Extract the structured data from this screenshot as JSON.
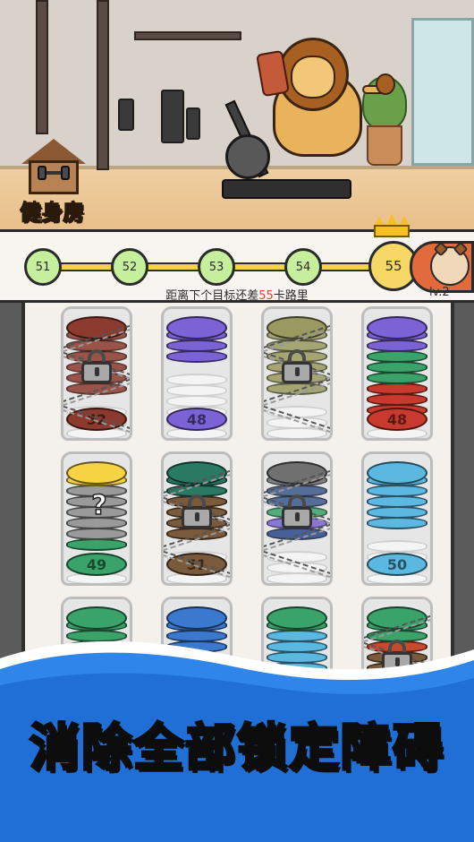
{
  "location": {
    "name": "健身房"
  },
  "progress": {
    "nodes": [
      "51",
      "52",
      "53",
      "54",
      "55"
    ],
    "current_node": "55",
    "target_prefix": "距离下个目标还差",
    "target_value": "55",
    "target_suffix": "卡路里",
    "level": "lv.2"
  },
  "tubes": [
    {
      "id": "t1",
      "locked": true,
      "colors": [
        "#8c3a2e",
        "#8c3a2e",
        "#8c3a2e",
        "#8c3a2e",
        "#8c3a2e",
        "#8c3a2e",
        "#8c3a2e"
      ],
      "label": "52",
      "faded": true
    },
    {
      "id": "t2",
      "locked": false,
      "colors": [
        "#7b63d6",
        "#7b63d6",
        "#7b63d6",
        "#7b63d6"
      ],
      "label": "48"
    },
    {
      "id": "t3",
      "locked": true,
      "colors": [
        "#9a9a60",
        "#9a9a60",
        "#9a9a60",
        "#9a9a60",
        "#9a9a60",
        "#9a9a60",
        "#9a9a60"
      ],
      "label": "",
      "faded": true
    },
    {
      "id": "t4",
      "locked": false,
      "colors": [
        "#7b63d6",
        "#7b63d6",
        "#7b63d6",
        "#3aa36a",
        "#3aa36a",
        "#3aa36a",
        "#c83a2e",
        "#c83a2e",
        "#c83a2e"
      ],
      "label": "48"
    },
    {
      "id": "t5",
      "locked": false,
      "mystery": true,
      "colors": [
        "#f5d342",
        "#f5d342",
        "#9a9a9a",
        "#9a9a9a",
        "#9a9a9a",
        "#9a9a9a",
        "#9a9a9a",
        "#3aa36a"
      ],
      "label": "49"
    },
    {
      "id": "t6",
      "locked": true,
      "colors": [
        "#2a7a63",
        "#2a7a63",
        "#2a7a63",
        "#7a5a3a",
        "#7a5a3a",
        "#7a5a3a",
        "#7a5a3a"
      ],
      "label": "51"
    },
    {
      "id": "t7",
      "locked": true,
      "colors": [
        "#707070",
        "#707070",
        "#3b5a8a",
        "#3b5a8a",
        "#3aa36a",
        "#7b63d6",
        "#2a4a8a"
      ],
      "label": "",
      "faded": true
    },
    {
      "id": "t8",
      "locked": false,
      "colors": [
        "#5bb8e0",
        "#5bb8e0",
        "#5bb8e0",
        "#5bb8e0",
        "#5bb8e0",
        "#5bb8e0"
      ],
      "label": "50"
    },
    {
      "id": "t9",
      "locked": false,
      "colors": [
        "#3aa36a",
        "#3aa36a",
        "#3aa36a",
        "#3aa36a",
        "#3aa36a"
      ],
      "label": ""
    },
    {
      "id": "t10",
      "locked": false,
      "colors": [
        "#3b79cf",
        "#3b79cf",
        "#3b79cf",
        "#3b79cf",
        "#3b79cf"
      ],
      "label": ""
    },
    {
      "id": "t11",
      "locked": false,
      "colors": [
        "#3aa36a",
        "#3aa36a",
        "#5bb8e0",
        "#5bb8e0",
        "#5bb8e0",
        "#5bb8e0"
      ],
      "label": ""
    },
    {
      "id": "t12",
      "locked": true,
      "colors": [
        "#3aa36a",
        "#3aa36a",
        "#3aa36a",
        "#c84a2e",
        "#7a5a3a",
        "#7a5a3a"
      ],
      "label": ""
    }
  ],
  "banner": {
    "text": "消除全部锁定障碍"
  }
}
